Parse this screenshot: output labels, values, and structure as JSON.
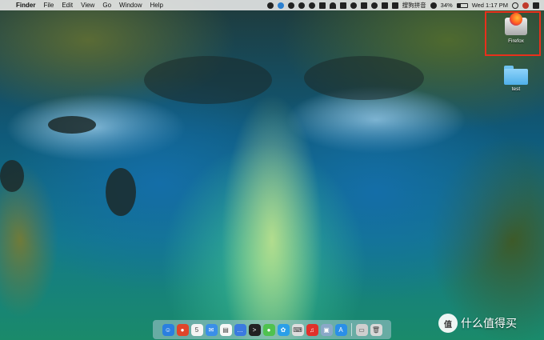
{
  "menubar": {
    "apple_glyph": "",
    "app_name": "Finder",
    "menus": [
      "File",
      "Edit",
      "View",
      "Go",
      "Window",
      "Help"
    ],
    "status": {
      "icons": [
        "scroll-icon",
        "cloud-icon",
        "messages-icon",
        "cloud-upload-icon",
        "wechat-icon",
        "music-icon",
        "wifi-icon",
        "airplay-icon",
        "clock-icon",
        "display-icon",
        "volume-icon",
        "keyboard-icon",
        "sogou-icon",
        "bluetooth-icon"
      ],
      "input_method": "搜狗拼音",
      "battery_percent": "34%",
      "battery_level": 0.34,
      "clock": "Wed 1:17 PM"
    }
  },
  "desktop": {
    "firefox_label": "Firefox",
    "test_label": "test"
  },
  "dock": {
    "apps": [
      {
        "name": "finder-dock-icon",
        "color": "#2a7fe0",
        "glyph": "☺"
      },
      {
        "name": "chrome-dock-icon",
        "color": "#e0452a",
        "glyph": "●"
      },
      {
        "name": "calendar-dock-icon",
        "color": "#f4f4f4",
        "glyph": "5"
      },
      {
        "name": "mail-dock-icon",
        "color": "#3a8fe8",
        "glyph": "✉"
      },
      {
        "name": "notes-dock-icon",
        "color": "#f7f7f7",
        "glyph": "▤"
      },
      {
        "name": "feedback-dock-icon",
        "color": "#3a7ae0",
        "glyph": "…"
      },
      {
        "name": "terminal-dock-icon",
        "color": "#222222",
        "glyph": ">"
      },
      {
        "name": "wechat-dock-icon",
        "color": "#4fc24f",
        "glyph": "●"
      },
      {
        "name": "qq-dock-icon",
        "color": "#2a9fe8",
        "glyph": "✿"
      },
      {
        "name": "keyboard-dock-icon",
        "color": "#dddddd",
        "glyph": "⌨"
      },
      {
        "name": "netease-music-dock-icon",
        "color": "#e0302a",
        "glyph": "♫"
      },
      {
        "name": "preview-dock-icon",
        "color": "#8aa8c8",
        "glyph": "▣"
      },
      {
        "name": "app-store-dock-icon",
        "color": "#2a8fe8",
        "glyph": "A"
      },
      {
        "name": "disk-dock-icon",
        "color": "#cfcfcf",
        "glyph": "▭"
      },
      {
        "name": "trash-dock-icon",
        "color": "#d8d8d8",
        "glyph": "🗑"
      }
    ]
  },
  "watermark": {
    "badge": "值",
    "text": "什么值得买"
  }
}
